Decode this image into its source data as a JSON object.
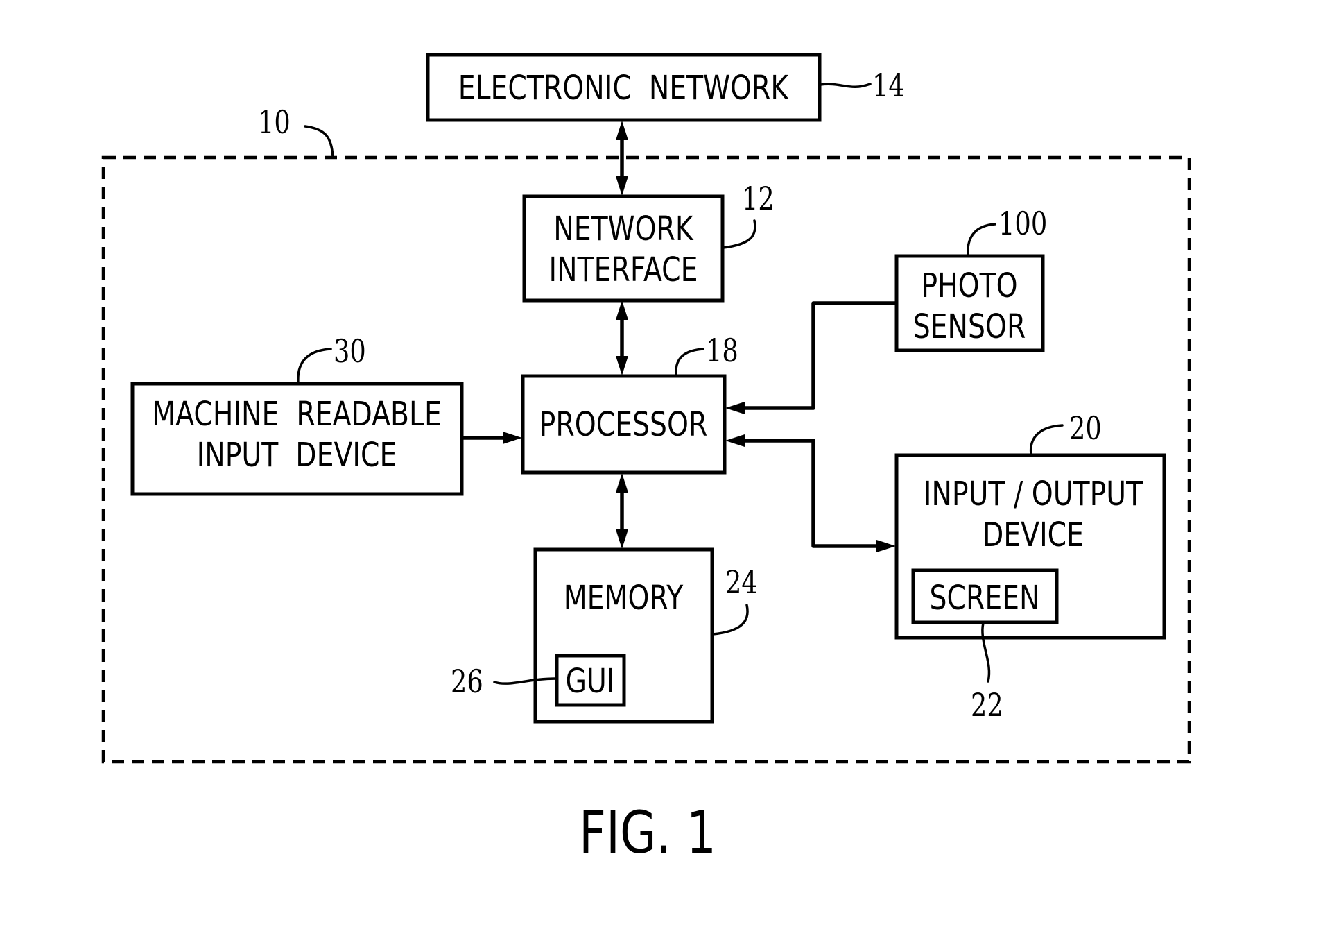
{
  "figure": {
    "caption": "FIG. 1",
    "system_ref": "10",
    "blocks": {
      "electronic_network": {
        "lines": [
          "ELECTRONIC  NETWORK"
        ],
        "ref": "14"
      },
      "network_interface": {
        "lines": [
          "NETWORK",
          "INTERFACE"
        ],
        "ref": "12"
      },
      "photo_sensor": {
        "lines": [
          "PHOTO",
          "SENSOR"
        ],
        "ref": "100"
      },
      "machine_readable_input": {
        "lines": [
          "MACHINE  READABLE",
          "INPUT  DEVICE"
        ],
        "ref": "30"
      },
      "processor": {
        "lines": [
          "PROCESSOR"
        ],
        "ref": "18"
      },
      "io_device": {
        "lines": [
          "INPUT / OUTPUT",
          "DEVICE"
        ],
        "ref": "20"
      },
      "screen": {
        "lines": [
          "SCREEN"
        ],
        "ref": "22"
      },
      "memory": {
        "lines": [
          "MEMORY"
        ],
        "ref": "24"
      },
      "gui": {
        "lines": [
          "GUI"
        ],
        "ref": "26"
      }
    },
    "connections": [
      {
        "from": "electronic_network",
        "to": "network_interface",
        "direction": "bidirectional"
      },
      {
        "from": "network_interface",
        "to": "processor",
        "direction": "bidirectional"
      },
      {
        "from": "machine_readable_input",
        "to": "processor",
        "direction": "one-way"
      },
      {
        "from": "photo_sensor",
        "to": "processor",
        "direction": "one-way"
      },
      {
        "from": "processor",
        "to": "io_device",
        "direction": "bidirectional"
      },
      {
        "from": "processor",
        "to": "memory",
        "direction": "bidirectional"
      }
    ]
  }
}
